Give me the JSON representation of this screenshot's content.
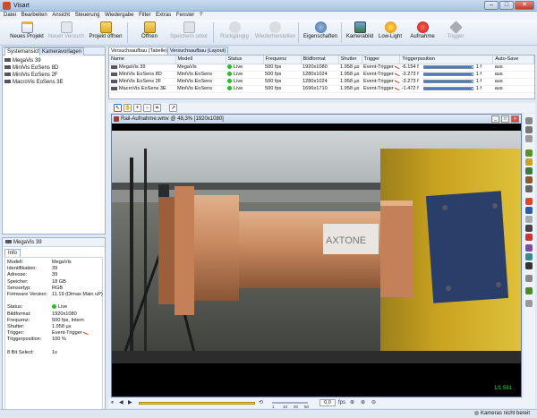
{
  "window": {
    "title": "Visart",
    "min_label": "–",
    "max_label": "□",
    "close_label": "✕"
  },
  "menu": [
    "Datei",
    "Bearbeiten",
    "Ansicht",
    "Steuerung",
    "Wiedergabe",
    "Filter",
    "Extras",
    "Fenster",
    "?"
  ],
  "toolbar": {
    "buttons": [
      {
        "label": "Neues Projekt",
        "icon": "new-project-icon",
        "enabled": true
      },
      {
        "label": "Neuer Versuch",
        "icon": "new-test-icon",
        "enabled": false
      },
      {
        "label": "Projekt öffnen",
        "icon": "open-project-icon",
        "enabled": true
      },
      {
        "label": "Öffnen",
        "icon": "open-folder-icon",
        "enabled": true
      },
      {
        "label": "Speichern unter",
        "icon": "save-as-icon",
        "enabled": false
      },
      {
        "label": "Rückgängig",
        "icon": "undo-icon",
        "enabled": false
      },
      {
        "label": "Wiederherstellen",
        "icon": "redo-icon",
        "enabled": false
      },
      {
        "label": "Eigenschaften",
        "icon": "properties-icon",
        "enabled": true
      },
      {
        "label": "Kamerabild",
        "icon": "camera-image-icon",
        "enabled": true
      },
      {
        "label": "Low-Light",
        "icon": "low-light-icon",
        "enabled": true
      },
      {
        "label": "Aufnahme",
        "icon": "record-icon",
        "enabled": true
      },
      {
        "label": "Trigger",
        "icon": "trigger-icon",
        "enabled": false
      }
    ]
  },
  "left": {
    "tabs": [
      "Systemansicht",
      "Kameravorlagen"
    ],
    "tree": [
      "MegaVis 39",
      "MiniVis EoSens 8D",
      "MiniVis EoSens 2F",
      "MacroVis EoSens 3E"
    ]
  },
  "info": {
    "header": "MegaVis 39",
    "tab": "Info",
    "rows": [
      {
        "k": "Modell:",
        "v": "MegaVis"
      },
      {
        "k": "Identifikation:",
        "v": "39"
      },
      {
        "k": "Adresse:",
        "v": "39"
      },
      {
        "k": "Speicher:",
        "v": "18 GB"
      },
      {
        "k": "Sensortyp:",
        "v": "RGB"
      },
      {
        "k": "Firmware Version:",
        "v": "11.19 (Dimax Main uP)"
      },
      {
        "k": "",
        "v": ""
      },
      {
        "k": "Status:",
        "v": "Live"
      },
      {
        "k": "Bildformat:",
        "v": "1920x1080"
      },
      {
        "k": "Frequenz:",
        "v": "500 fps, Intern"
      },
      {
        "k": "Shutter:",
        "v": "1.958 µs"
      },
      {
        "k": "Trigger:",
        "v": "Event-Trigger"
      },
      {
        "k": "Triggerposition:",
        "v": "100 %"
      },
      {
        "k": "",
        "v": ""
      },
      {
        "k": "8 Bit Select:",
        "v": "1x"
      }
    ]
  },
  "main": {
    "tabs": [
      "Versuchsaufbau (Tabelle)",
      "Versuchsaufbau (Layout)"
    ],
    "columns": [
      "Name",
      "Modell",
      "Status",
      "Frequenz",
      "Bildformat",
      "Shutter",
      "Trigger",
      "Triggerposition",
      "Auto-Save"
    ],
    "rows": [
      {
        "name": "MegaVis 39",
        "model": "MegaVis",
        "status": "Live",
        "freq": "500 fps",
        "format": "1920x1080",
        "shutter": "1.958 µs",
        "trigger": "Event-Trigger",
        "pos": "-6.154 f",
        "frames": "1 f",
        "fill": 0.98,
        "autosave": "aus"
      },
      {
        "name": "MiniVis EoSens 8D",
        "model": "MiniVis EoSens",
        "status": "Live",
        "freq": "500 fps",
        "format": "1280x1024",
        "shutter": "1.958 µs",
        "trigger": "Event-Trigger",
        "pos": "-3.273 f",
        "frames": "1 f",
        "fill": 0.98,
        "autosave": "aus"
      },
      {
        "name": "MiniVis EoSens 2F",
        "model": "MiniVis EoSens",
        "status": "Live",
        "freq": "500 fps",
        "format": "1280x1024",
        "shutter": "1.958 µs",
        "trigger": "Event-Trigger",
        "pos": "-3.273 f",
        "frames": "1 f",
        "fill": 0.98,
        "autosave": "aus"
      },
      {
        "name": "MacroVis EoSens 3E",
        "model": "MiniVis EoSens",
        "status": "Live",
        "freq": "500 fps",
        "format": "1696x1710",
        "shutter": "1.958 µs",
        "trigger": "Event-Trigger",
        "pos": "-1.472 f",
        "frames": "1 f",
        "fill": 0.98,
        "autosave": "aus"
      }
    ]
  },
  "video": {
    "title": "Rail-Aufnahme.wmv @ 48,3% [1920x1080]",
    "brand": "AXTONE",
    "frame_counter": "1/1.581"
  },
  "playback": {
    "speed_ticks": [
      "1",
      "10",
      "20",
      "50"
    ],
    "zoom_value": "0,0",
    "zoom_unit": "fps"
  },
  "status": {
    "text": "Kameras nicht bereit"
  },
  "colors": {
    "live": "#23c023",
    "accent": "#4b7bbd",
    "record": "#d62020"
  }
}
